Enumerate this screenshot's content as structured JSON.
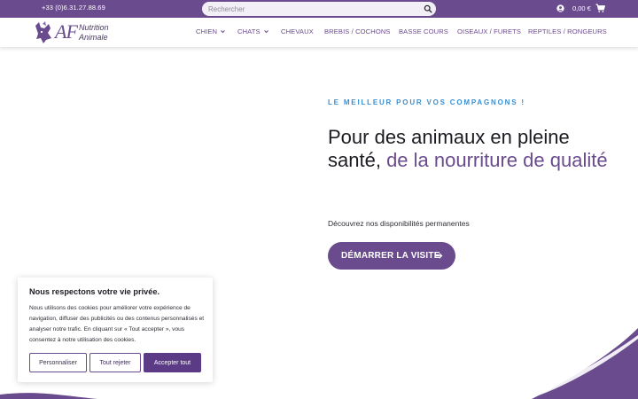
{
  "topbar": {
    "phone": "+33 (0)6.31.27.88.69",
    "search_placeholder": "Rechercher",
    "cart_total": "0,00 €",
    "icons": [
      "search-icon",
      "account-icon",
      "cart-icon"
    ]
  },
  "logo": {
    "initials": "AF",
    "line1": "Nutrition",
    "line2": "Animale"
  },
  "nav": {
    "items": [
      {
        "label": "CHIEN",
        "has_dropdown": true
      },
      {
        "label": "CHATS",
        "has_dropdown": true
      },
      {
        "label": "CHEVAUX",
        "has_dropdown": false
      },
      {
        "label": "BREBIS / COCHONS",
        "has_dropdown": false
      },
      {
        "label": "BASSE COURS",
        "has_dropdown": false
      },
      {
        "label": "OISEAUX / FURETS",
        "has_dropdown": false
      },
      {
        "label": "REPTILES / RONGEURS",
        "has_dropdown": false
      }
    ]
  },
  "hero": {
    "eyebrow": "LE MEILLEUR POUR VOS COMPAGNONS !",
    "title_part1": "Pour des animaux en pleine santé,",
    "title_part2": "de la nourriture de qualité",
    "subtitle": "Découvrez nos disponibilités permanentes",
    "cta_label": "DÉMARRER LA VISITE"
  },
  "cookie": {
    "title": "Nous respectons votre vie privée.",
    "text": "Nous utilisons des cookies pour améliorer votre expérience de navigation, diffuser des publicités ou des contenus personnalisés et analyser notre trafic. En cliquant sur « Tout accepter », vous consentez à notre utilisation des cookies.",
    "btn_customize": "Personnaliser",
    "btn_reject": "Tout rejeter",
    "btn_accept": "Accepter tout"
  },
  "colors": {
    "brand_purple": "#6a4c8e",
    "accent_blue": "#3a8fd0",
    "text_dark": "#1b1b22"
  }
}
